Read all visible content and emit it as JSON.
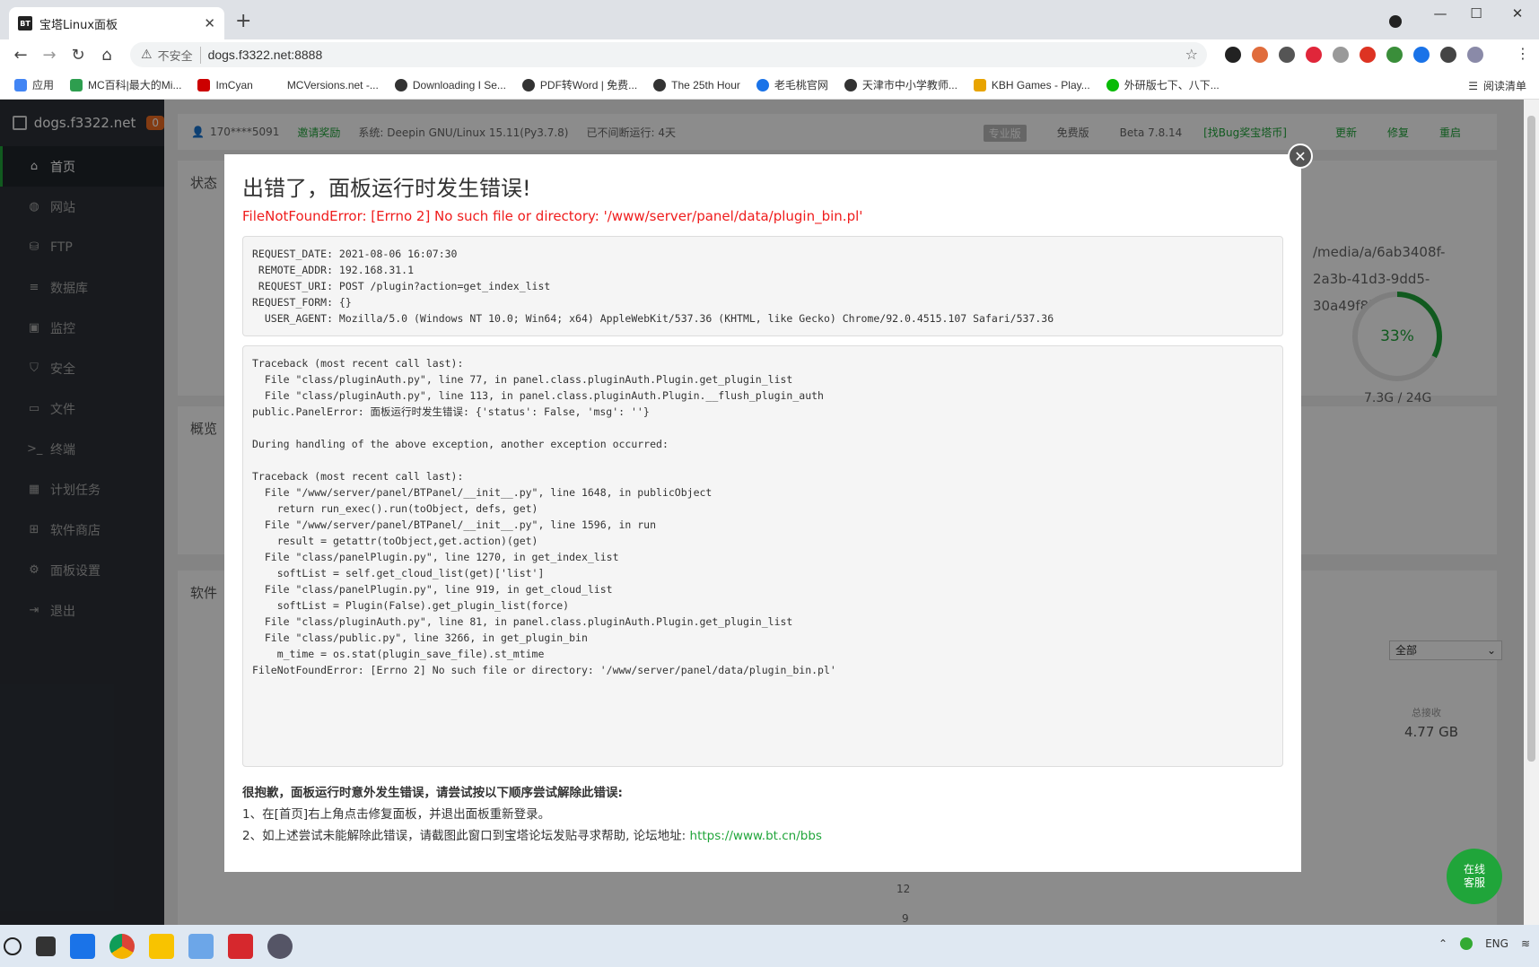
{
  "browser": {
    "tab_title": "宝塔Linux面板",
    "tab_favicon": "BT",
    "insecure_label": "不安全",
    "url": "dogs.f3322.net:8888",
    "bookmarks": [
      {
        "label": "应用",
        "color": "#4285f4"
      },
      {
        "label": "MC百科|最大的Mi...",
        "color": "#2e9e4f"
      },
      {
        "label": "ImCyan",
        "color": "#c00"
      },
      {
        "label": "MCVersions.net -...",
        "color": "#ffffff"
      },
      {
        "label": "Downloading I Se...",
        "color": "#333"
      },
      {
        "label": "PDF转Word | 免费...",
        "color": "#333"
      },
      {
        "label": "The 25th Hour",
        "color": "#333"
      },
      {
        "label": "老毛桃官网",
        "color": "#1a73e8"
      },
      {
        "label": "天津市中小学教师...",
        "color": "#333"
      },
      {
        "label": "KBH Games - Play...",
        "color": "#e8a400"
      },
      {
        "label": "外研版七下、八下...",
        "color": "#09bb07"
      }
    ],
    "reading_list": "阅读清单"
  },
  "panel": {
    "brand": "dogs.f3322.net",
    "badge": "0",
    "nav": [
      {
        "label": "首页",
        "icon": "home-icon",
        "glyph": "⌂"
      },
      {
        "label": "网站",
        "icon": "globe-icon",
        "glyph": "◍"
      },
      {
        "label": "FTP",
        "icon": "ftp-icon",
        "glyph": "⛁"
      },
      {
        "label": "数据库",
        "icon": "database-icon",
        "glyph": "≡"
      },
      {
        "label": "监控",
        "icon": "monitor-icon",
        "glyph": "▣"
      },
      {
        "label": "安全",
        "icon": "shield-icon",
        "glyph": "⛉"
      },
      {
        "label": "文件",
        "icon": "folder-icon",
        "glyph": "▭"
      },
      {
        "label": "终端",
        "icon": "terminal-icon",
        "glyph": ">_"
      },
      {
        "label": "计划任务",
        "icon": "calendar-icon",
        "glyph": "▦"
      },
      {
        "label": "软件商店",
        "icon": "grid-icon",
        "glyph": "⊞"
      },
      {
        "label": "面板设置",
        "icon": "gear-icon",
        "glyph": "⚙"
      },
      {
        "label": "退出",
        "icon": "logout-icon",
        "glyph": "⇥"
      }
    ],
    "user": "170****5091",
    "invite": "邀请奖励",
    "system": "系统:  Deepin GNU/Linux 15.11(Py3.7.8)",
    "uptime": "已不间断运行: 4天",
    "pro_tag": "专业版",
    "edition": "免费版",
    "version": "Beta 7.8.14",
    "bug_link": "[找Bug奖宝塔币]",
    "update": "更新",
    "repair": "修复",
    "restart": "重启",
    "card_status": "状态",
    "card_overview": "概览",
    "card_software": "软件",
    "disk_path": "/media/a/6ab3408f-2a3b-41d3-9dd5-30a49f8b4a1b",
    "disk_percent": "33%",
    "disk_fraction": 0.33,
    "disk_size": "7.3G / 24G",
    "select_value": "全部",
    "net_label": "总接收",
    "net_value": "4.77 GB",
    "axis_12": "12",
    "axis_9": "9",
    "service_line1": "在线",
    "service_line2": "客服"
  },
  "dialog": {
    "title": "出错了，面板运行时发生错误!",
    "subtitle": "FileNotFoundError: [Errno 2] No such file or directory: '/www/server/panel/data/plugin_bin.pl'",
    "request": "REQUEST_DATE: 2021-08-06 16:07:30\n REMOTE_ADDR: 192.168.31.1\n REQUEST_URI: POST /plugin?action=get_index_list\nREQUEST_FORM: {}\n  USER_AGENT: Mozilla/5.0 (Windows NT 10.0; Win64; x64) AppleWebKit/537.36 (KHTML, like Gecko) Chrome/92.0.4515.107 Safari/537.36",
    "traceback": "Traceback (most recent call last):\n  File \"class/pluginAuth.py\", line 77, in panel.class.pluginAuth.Plugin.get_plugin_list\n  File \"class/pluginAuth.py\", line 113, in panel.class.pluginAuth.Plugin.__flush_plugin_auth\npublic.PanelError: 面板运行时发生错误: {'status': False, 'msg': ''}\n\nDuring handling of the above exception, another exception occurred:\n\nTraceback (most recent call last):\n  File \"/www/server/panel/BTPanel/__init__.py\", line 1648, in publicObject\n    return run_exec().run(toObject, defs, get)\n  File \"/www/server/panel/BTPanel/__init__.py\", line 1596, in run\n    result = getattr(toObject,get.action)(get)\n  File \"class/panelPlugin.py\", line 1270, in get_index_list\n    softList = self.get_cloud_list(get)['list']\n  File \"class/panelPlugin.py\", line 919, in get_cloud_list\n    softList = Plugin(False).get_plugin_list(force)\n  File \"class/pluginAuth.py\", line 81, in panel.class.pluginAuth.Plugin.get_plugin_list\n  File \"class/public.py\", line 3266, in get_plugin_bin\n    m_time = os.stat(plugin_save_file).st_mtime\nFileNotFoundError: [Errno 2] No such file or directory: '/www/server/panel/data/plugin_bin.pl'",
    "help_title": "很抱歉，面板运行时意外发生错误，请尝试按以下顺序尝试解除此错误:",
    "help_1": "1、在[首页]右上角点击修复面板，并退出面板重新登录。",
    "help_2": "2、如上述尝试未能解除此错误，请截图此窗口到宝塔论坛发贴寻求帮助, 论坛地址:",
    "help_link": "https://www.bt.cn/bbs"
  },
  "taskbar": {
    "lang": "ENG",
    "apps": [
      "search-icon",
      "task-view-icon",
      "widgets-icon",
      "chrome-icon",
      "explorer-icon",
      "photos-icon",
      "study-app-icon",
      "settings-icon"
    ]
  }
}
